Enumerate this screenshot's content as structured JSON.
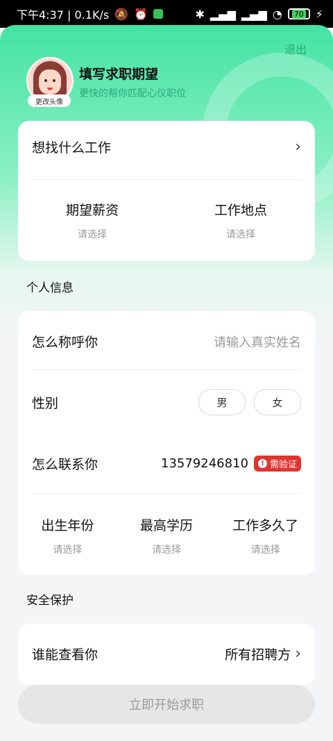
{
  "status_bar": {
    "time_speed": "下午4:37 | 0.1K/s",
    "battery": "70"
  },
  "header": {
    "exit_label": "退出",
    "change_avatar_label": "更改头像",
    "title": "填写求职期望",
    "subtitle": "更快的帮你匹配心仪职位"
  },
  "job_card": {
    "what_job_label": "想找什么工作",
    "salary_label": "期望薪资",
    "salary_value": "请选择",
    "location_label": "工作地点",
    "location_value": "请选择"
  },
  "personal_info": {
    "section_title": "个人信息",
    "name_label": "怎么称呼你",
    "name_placeholder": "请输入真实姓名",
    "gender_label": "性别",
    "gender_options": [
      "男",
      "女"
    ],
    "contact_label": "怎么联系你",
    "phone": "13579246810",
    "verify_badge": "需验证",
    "birth_year_label": "出生年份",
    "birth_year_value": "请选择",
    "education_label": "最高学历",
    "education_value": "请选择",
    "work_years_label": "工作多久了",
    "work_years_value": "请选择"
  },
  "security": {
    "section_title": "安全保护",
    "who_can_view_label": "谁能查看你",
    "who_can_view_value": "所有招聘方"
  },
  "start_button_label": "立即开始求职",
  "colors": {
    "accent_green": "#43e3a3",
    "subtitle_green": "#2aa877",
    "verify_red": "#e0342f"
  }
}
